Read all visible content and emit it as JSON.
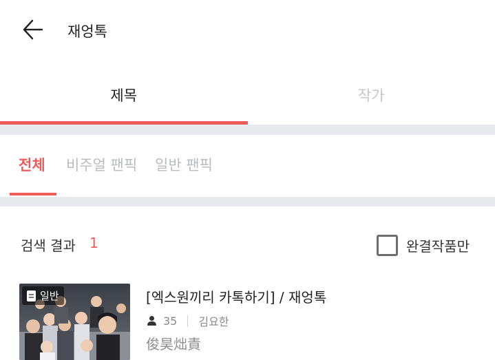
{
  "colors": {
    "accent": "#ef5b58"
  },
  "header": {
    "title": "재엉톡",
    "back_icon": "arrow-left-icon"
  },
  "main_tabs": [
    {
      "label": "제목",
      "active": true
    },
    {
      "label": "작가",
      "active": false
    }
  ],
  "sub_tabs": [
    {
      "label": "전체",
      "active": true
    },
    {
      "label": "비주얼 팬픽",
      "active": false
    },
    {
      "label": "일반 팬픽",
      "active": false
    }
  ],
  "results": {
    "label": "검색 결과",
    "count": "1",
    "complete_only_label": "완결작품만",
    "complete_only_checked": false
  },
  "items": [
    {
      "badge": "일반",
      "title": "[엑스원끼리 카톡하기] / 재엉톡",
      "reader_count": "35",
      "author": "김요한",
      "description": "俊昊炪責"
    }
  ]
}
